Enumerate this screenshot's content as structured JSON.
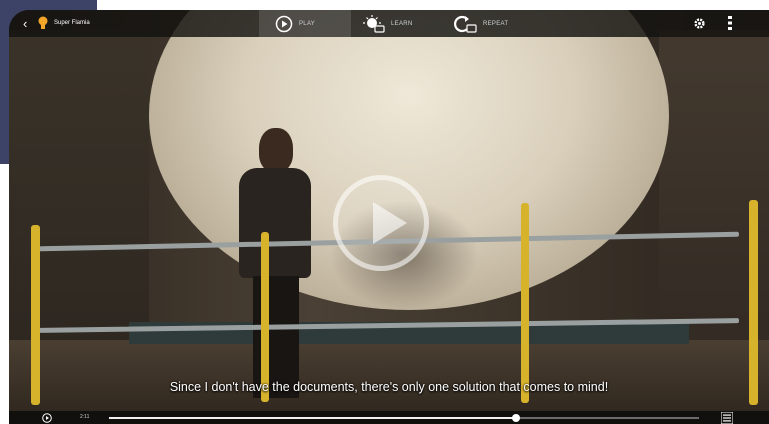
{
  "header": {
    "back_icon": "chevron-left-icon",
    "logo_icon": "lightbulb-logo-icon",
    "show_title": "Super Flamia",
    "modes": [
      {
        "label": "PLAY",
        "icon": "play-circle-icon",
        "active": true
      },
      {
        "label": "LEARN",
        "icon": "learn-icon",
        "active": false
      },
      {
        "label": "REPEAT",
        "icon": "repeat-icon",
        "active": false
      }
    ],
    "settings_icon": "gear-icon",
    "more_icon": "more-vertical-icon"
  },
  "video": {
    "subtitle": "Since I don't have the documents, there's only one solution that comes to mind!",
    "center_icon": "play-icon"
  },
  "controls": {
    "play_icon": "play-circle-icon",
    "time": "2:11",
    "progress": 0.69,
    "list_icon": "subtitle-list-icon"
  },
  "colors": {
    "accent_yellow": "#d7b32b",
    "side_panel": "#3d4366",
    "bar_bg": "#141210"
  }
}
